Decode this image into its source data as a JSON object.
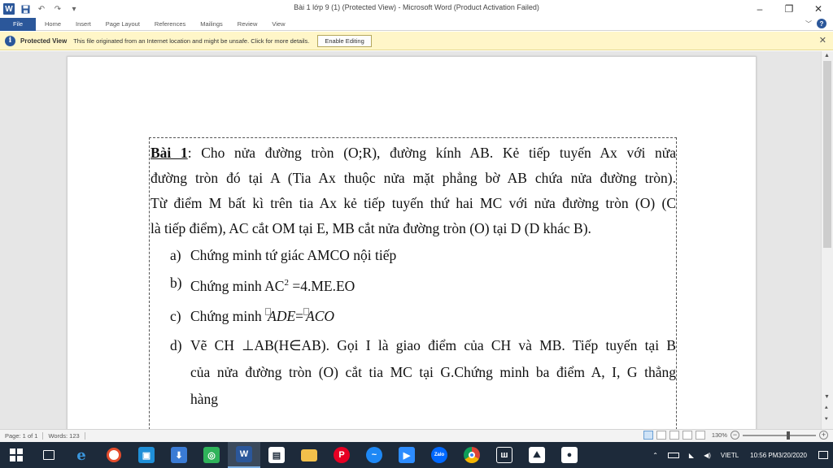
{
  "titlebar": {
    "app_logo": "W",
    "title": "Bài 1 lớp 9 (1) (Protected View) - Microsoft Word (Product Activation Failed)",
    "minimize": "–",
    "restore": "❐",
    "close": "✕"
  },
  "ribbon": {
    "tabs": [
      "File",
      "Home",
      "Insert",
      "Page Layout",
      "References",
      "Mailings",
      "Review",
      "View"
    ],
    "help": "?"
  },
  "protected_view": {
    "label": "Protected View",
    "message": "This file originated from an Internet location and might be unsafe. Click for more details.",
    "enable_button": "Enable Editing",
    "close": "✕"
  },
  "document": {
    "para1_lines": [
      [
        "Bài 1",
        ": Cho nửa đường tròn (O;R), đường kính AB. Kẻ tiếp tuyến Ax với nửa"
      ],
      [
        "",
        "đường tròn đó tại A (Tia Ax thuộc nửa mặt phẳng bờ AB chứa nửa đường tròn)."
      ],
      [
        "",
        "Từ điểm M bất kì trên tia Ax kẻ tiếp tuyến thứ hai MC với nửa đường tròn (O) (C"
      ],
      [
        "",
        "là tiếp điểm), AC cắt OM tại E, MB cắt nửa đường tròn (O) tại D (D khác B)."
      ]
    ],
    "item_a_marker": "a)",
    "item_a": "Chứng minh tứ giác AMCO nội tiếp",
    "item_b_marker": "b)",
    "item_b_pre": "Chứng minh AC",
    "item_b_sup": "2",
    "item_b_post": " =4.ME.EO",
    "item_c_marker": "c)",
    "item_c_pre": "Chứng minh ",
    "item_c_angle1": "ADE",
    "item_c_eq": "=",
    "item_c_angle2": "ACO",
    "item_d_marker": "d)",
    "item_d_lines": [
      "Vẽ CH  ⊥AB(H∈AB). Gọi I là giao điểm của CH và MB. Tiếp tuyến tại B",
      "của nửa đường tròn (O) cắt tia MC tại  G.Chứng minh ba điểm A, I, G thẳng",
      "hàng"
    ]
  },
  "statusbar": {
    "page": "Page: 1 of 1",
    "words": "Words: 123",
    "zoom": "130%"
  },
  "taskbar": {
    "icons": [
      "windows-start-icon",
      "task-view-icon",
      "edge-icon",
      "media-icon",
      "store-icon",
      "app-icon",
      "camera-app-icon",
      "word-icon",
      "shopping-icon",
      "folder-icon",
      "pinterest-icon",
      "messenger-icon",
      "video-icon",
      "zalo-icon",
      "chrome-icon",
      "app-w-icon",
      "photos-icon",
      "camera-icon"
    ],
    "zalo_label": "Zalo",
    "lang_top": "VIE",
    "lang_bottom": "TL",
    "time": "10:56 PM",
    "date": "3/20/2020"
  }
}
